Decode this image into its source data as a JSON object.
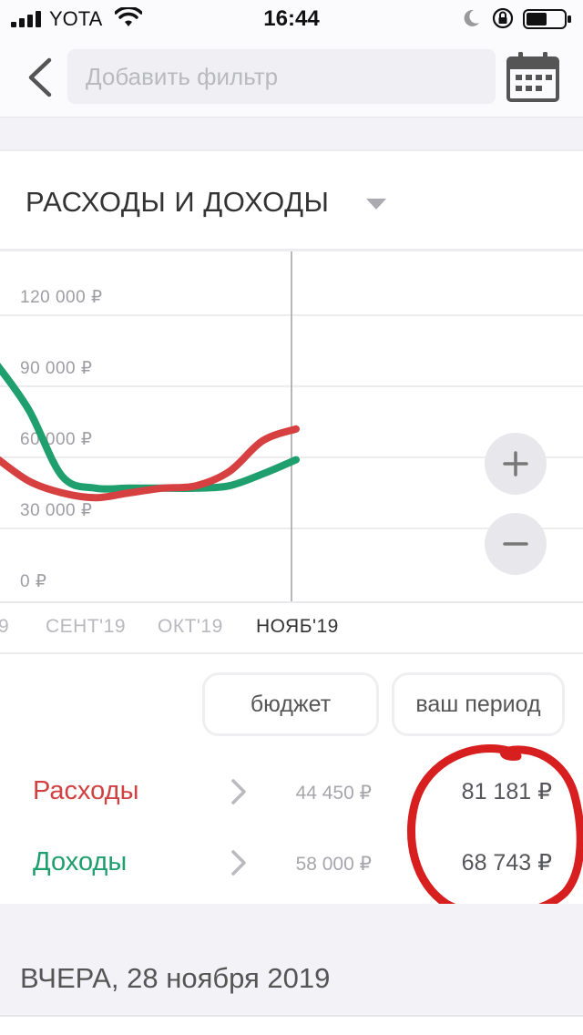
{
  "status_bar": {
    "carrier": "YOTA",
    "time": "16:44"
  },
  "nav": {
    "filter_placeholder": "Добавить фильтр",
    "back_icon": "chevron-left-icon",
    "calendar_icon": "calendar-icon"
  },
  "section": {
    "title": "РАСХОДЫ И ДОХОДЫ",
    "dropdown_icon": "caret-down-icon"
  },
  "chart_data": {
    "type": "line",
    "y_ticks": [
      "120 000 ₽",
      "90 000 ₽",
      "60 000 ₽",
      "30 000 ₽",
      "0 ₽"
    ],
    "ylim": [
      0,
      120000
    ],
    "grid": true,
    "x_labels": [
      "9",
      "СЕНТ'19",
      "ОКТ'19",
      "НОЯБ'19"
    ],
    "x": [
      0,
      0.5,
      1,
      1.5,
      2,
      2.5,
      3,
      3.5,
      4,
      4.5
    ],
    "series": [
      {
        "color": "#1f9e6e",
        "values": [
          100000,
          80000,
          52000,
          47000,
          47000,
          47000,
          47000,
          48000,
          53000,
          59000
        ]
      },
      {
        "color": "#d64040",
        "values": [
          60000,
          50000,
          45000,
          43000,
          45000,
          47000,
          48000,
          54000,
          67000,
          72000
        ]
      }
    ]
  },
  "zoom": {
    "in_icon": "plus-icon",
    "out_icon": "minus-icon"
  },
  "pills": {
    "budget": "бюджет",
    "period": "ваш период"
  },
  "summary": {
    "expenses": {
      "label": "Расходы",
      "budget": "44 450 ₽",
      "actual": "81 181 ₽",
      "color": "#d14141"
    },
    "income": {
      "label": "Доходы",
      "budget": "58 000 ₽",
      "actual": "68 743 ₽",
      "color": "#1f9e6e"
    }
  },
  "feed": {
    "date_header": "ВЧЕРА, 28 ноября 2019"
  }
}
